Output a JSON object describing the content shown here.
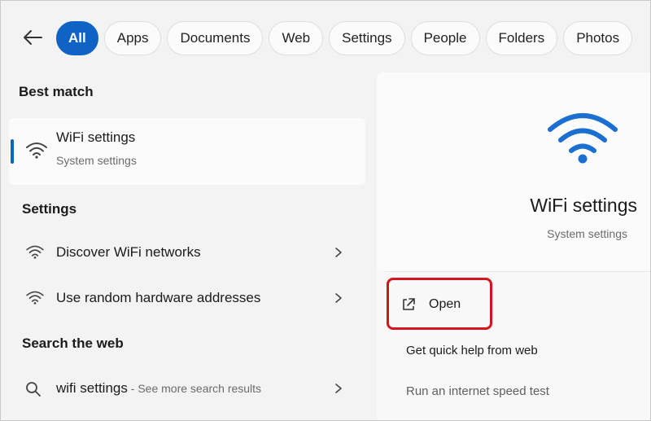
{
  "filters": {
    "chips": [
      "All",
      "Apps",
      "Documents",
      "Web",
      "Settings",
      "People",
      "Folders",
      "Photos"
    ],
    "active_index": 0
  },
  "best_match": {
    "heading": "Best match",
    "title": "WiFi settings",
    "subtitle": "System settings",
    "icon": "wifi-icon"
  },
  "settings": {
    "heading": "Settings",
    "items": [
      {
        "label": "Discover WiFi networks",
        "icon": "wifi-icon"
      },
      {
        "label": "Use random hardware addresses",
        "icon": "wifi-icon"
      }
    ]
  },
  "web": {
    "heading": "Search the web",
    "query": "wifi settings",
    "suffix": " - See more search results",
    "icon": "search-icon"
  },
  "preview": {
    "title": "WiFi settings",
    "subtitle": "System settings",
    "open_label": "Open",
    "actions": [
      "Get quick help from web",
      "Run an internet speed test"
    ]
  },
  "colors": {
    "accent": "#0f63c4",
    "highlight": "#d6141c"
  }
}
